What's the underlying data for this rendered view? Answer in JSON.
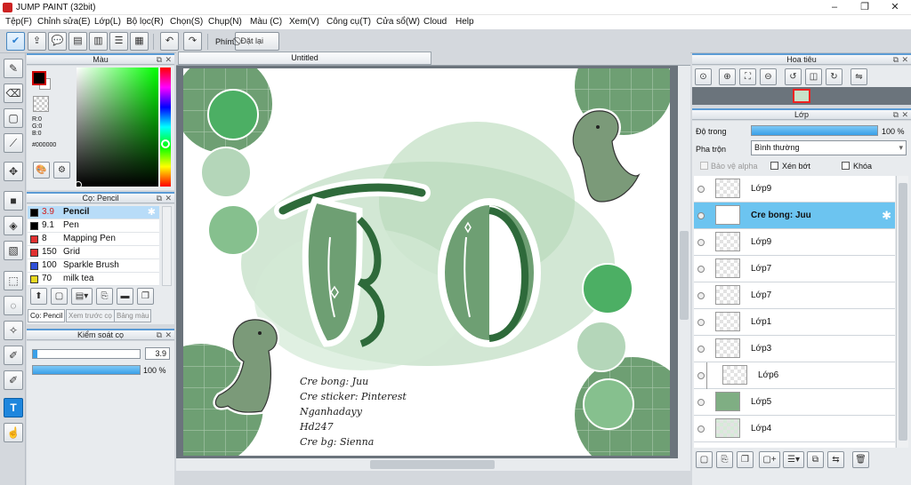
{
  "window": {
    "title": "JUMP PAINT (32bit)",
    "minimize": "–",
    "restore": "❐",
    "close": "✕"
  },
  "menu": [
    "Tệp(F)",
    "Chỉnh sửa(E)",
    "Lớp(L)",
    "Bộ lọc(R)",
    "Chọn(S)",
    "Chụp(N)",
    "Màu (C)",
    "Xem(V)",
    "Công cụ(T)",
    "Cửa sổ(W)",
    "Cloud",
    "Help"
  ],
  "toolbar": {
    "key_label": "Phím",
    "reset_label": "Đặt lại"
  },
  "color_panel": {
    "title": "Màu",
    "r": "R:0",
    "g": "G:0",
    "b": "B:0",
    "hex": "#000000"
  },
  "brush_panel": {
    "title": "Cọ: Pencil",
    "brushes": [
      {
        "size": "3.9",
        "name": "Pencil",
        "color": "#000000"
      },
      {
        "size": "9.1",
        "name": "Pen",
        "color": "#000000"
      },
      {
        "size": "8",
        "name": "Mapping Pen",
        "color": "#e03030"
      },
      {
        "size": "150",
        "name": "Grid",
        "color": "#e03030"
      },
      {
        "size": "100",
        "name": "Sparkle Brush",
        "color": "#3050d8"
      },
      {
        "size": "70",
        "name": "milk tea",
        "color": "#e8d820"
      }
    ],
    "tabs": [
      "Cọ: Pencil",
      "Xem trước cọ",
      "Bảng màu"
    ]
  },
  "brush_control": {
    "title": "Kiểm soát cọ",
    "size": "3.9",
    "opacity": "100 %",
    "opacity_fraction": 1.0,
    "size_fraction": 0.04
  },
  "canvas": {
    "tab": "Untitled",
    "big_text": "TO",
    "credits": [
      "Cre bong: Juu",
      "Cre sticker: Pinterest",
      "Nganhadayy",
      "Hd247",
      "Cre bg: Sienna"
    ]
  },
  "navigator": {
    "title": "Hoa tiêu"
  },
  "layer_panel": {
    "title": "Lớp",
    "opacity_label": "Độ trong",
    "opacity_value": "100 %",
    "blend_label": "Pha trộn",
    "blend_value": "Bình thường",
    "protect_alpha": "Bảo vệ alpha",
    "clipping": "Xén bớt",
    "lock": "Khóa",
    "layers": [
      "Lớp9",
      "Cre bong: Juu",
      "Lớp9",
      "Lớp7",
      "Lớp7",
      "Lớp1",
      "Lớp3",
      "Lớp6",
      "Lớp5",
      "Lớp4"
    ]
  },
  "colors": {
    "accent": "#1e86dd",
    "selected_layer": "#6cc4f0",
    "canvas_green": "#6e9f73",
    "dark_green": "#2e6a3a"
  }
}
